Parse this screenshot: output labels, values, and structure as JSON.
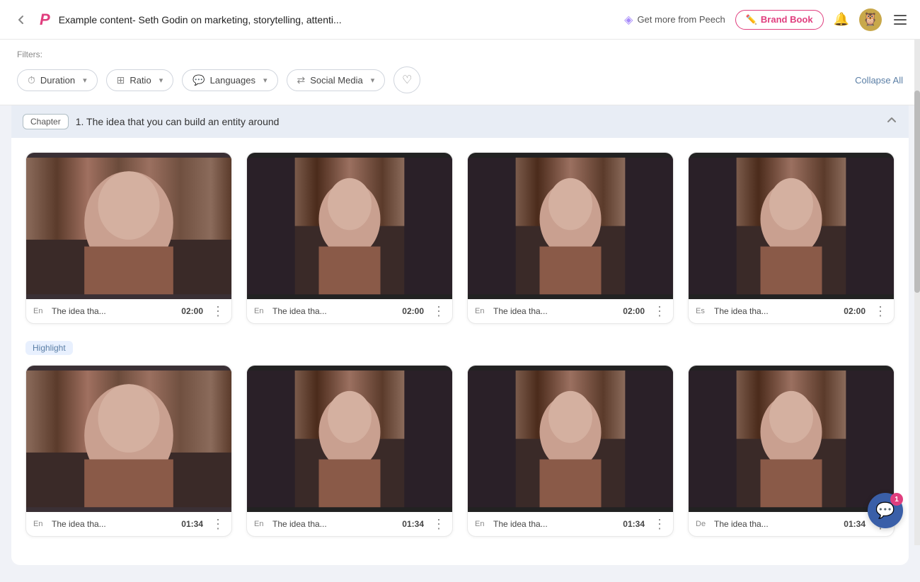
{
  "topnav": {
    "back_label": "←",
    "logo": "P",
    "title": "Example content- Seth Godin on marketing, storytelling, attenti...",
    "peech_promo": "Get more from Peech",
    "brand_book_label": "Brand Book",
    "menu_label": "≡",
    "diamond_icon": "◈",
    "bell_icon": "🔔",
    "avatar_icon": "🦉"
  },
  "filters": {
    "label": "Filters:",
    "duration_label": "Duration",
    "ratio_label": "Ratio",
    "languages_label": "Languages",
    "social_media_label": "Social Media",
    "collapse_all_label": "Collapse All",
    "clock_icon": "⏱",
    "ratio_icon": "⊞",
    "speech_icon": "💬",
    "share_icon": "⇄",
    "heart_icon": "♡"
  },
  "chapter": {
    "badge_label": "Chapter",
    "title": "1. The idea that you can build an entity around",
    "collapse_icon": "∧"
  },
  "top_row_cards": [
    {
      "lang": "En",
      "name": "The idea tha...",
      "duration": "02:00",
      "aspect": "landscape"
    },
    {
      "lang": "En",
      "name": "The idea tha...",
      "duration": "02:00",
      "aspect": "portrait"
    },
    {
      "lang": "En",
      "name": "The idea tha...",
      "duration": "02:00",
      "aspect": "portrait"
    },
    {
      "lang": "Es",
      "name": "The idea tha...",
      "duration": "02:00",
      "aspect": "portrait"
    }
  ],
  "highlight_label": "Highlight",
  "bottom_row_cards": [
    {
      "lang": "En",
      "name": "The idea tha...",
      "duration": "01:34",
      "aspect": "landscape"
    },
    {
      "lang": "En",
      "name": "The idea tha...",
      "duration": "01:34",
      "aspect": "portrait"
    },
    {
      "lang": "En",
      "name": "The idea tha...",
      "duration": "01:34",
      "aspect": "portrait"
    },
    {
      "lang": "De",
      "name": "The idea tha...",
      "duration": "01:34",
      "aspect": "portrait"
    }
  ],
  "chat": {
    "badge": "1",
    "icon": "💬"
  }
}
